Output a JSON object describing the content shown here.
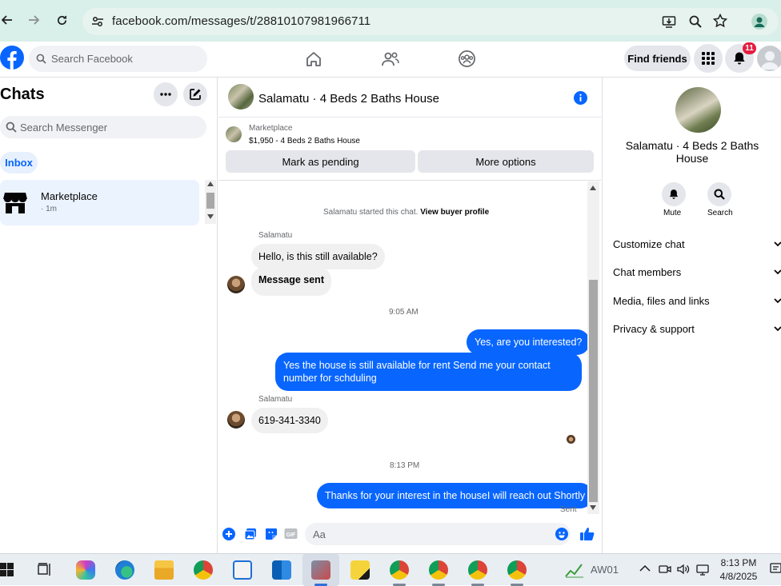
{
  "browser": {
    "url": "facebook.com/messages/t/28810107981966711"
  },
  "topnav": {
    "search_placeholder": "Search Facebook",
    "find_friends": "Find friends",
    "notification_count": "11"
  },
  "sidebar": {
    "title": "Chats",
    "search_placeholder": "Search Messenger",
    "filter_inbox": "Inbox",
    "chats": [
      {
        "name": "Marketplace",
        "meta": "· 1m"
      }
    ]
  },
  "conversation": {
    "title": "Salamatu · 4 Beds 2 Baths House",
    "listing": {
      "source": "Marketplace",
      "summary": "$1,950 - 4 Beds 2 Baths House",
      "btn_pending": "Mark as pending",
      "btn_more": "More options"
    },
    "started_note": "Salamatu started this chat.",
    "buyer_profile_link": "View buyer profile",
    "messages": [
      {
        "sender": "Salamatu",
        "text": "Hello, is this still available?"
      },
      {
        "text": "Message sent"
      },
      {
        "time": "9:05 AM"
      },
      {
        "text": "Yes, are you interested?"
      },
      {
        "text": "Yes the house is still available for rent Send me your contact number for schduling"
      },
      {
        "sender": "Salamatu",
        "text": "619-341-3340"
      },
      {
        "time": "8:13 PM"
      },
      {
        "text": "Thanks for your interest in the houseI will reach out Shortly",
        "status": "Sent"
      }
    ],
    "composer_placeholder": "Aa"
  },
  "right_panel": {
    "name": "Salamatu · 4 Beds 2 Baths House",
    "actions": [
      "Mute",
      "Search"
    ],
    "sections": [
      "Customize chat",
      "Chat members",
      "Media, files and links",
      "Privacy & support"
    ]
  },
  "taskbar": {
    "weather_label": "AW01",
    "time": "8:13 PM",
    "date": "4/8/2025"
  },
  "colors": {
    "accent": "#0866ff",
    "fb_blue": "#0866ff",
    "bubble_in": "#f0f0f0",
    "badge_red": "#e41e3f"
  }
}
